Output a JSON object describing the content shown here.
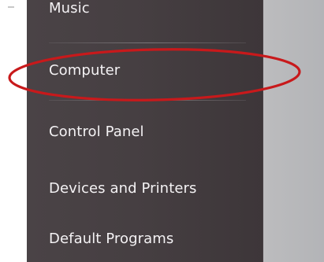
{
  "start_menu": {
    "items": [
      {
        "label": "Music"
      },
      {
        "label": "Computer"
      },
      {
        "label": "Control Panel"
      },
      {
        "label": "Devices and Printers"
      },
      {
        "label": "Default Programs"
      }
    ],
    "highlight_color": "#c8191b",
    "panel_color": "#463f42",
    "right_pane_color": "#b7b8bb"
  }
}
